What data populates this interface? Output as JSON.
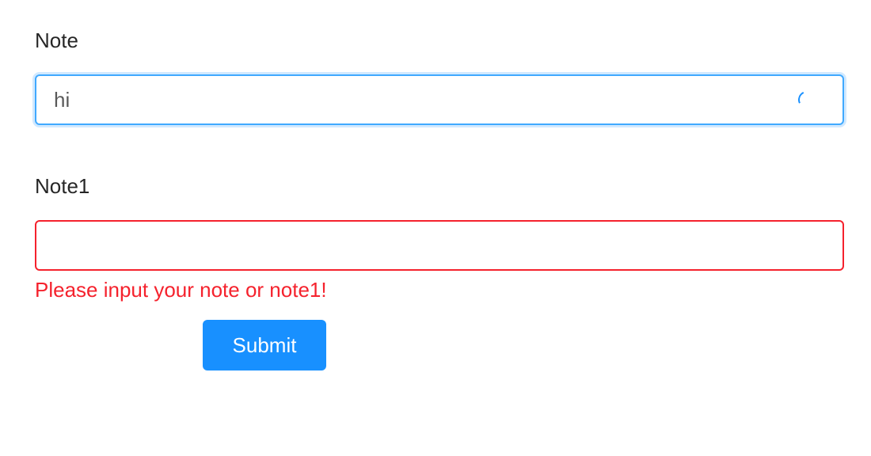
{
  "form": {
    "note": {
      "label": "Note",
      "value": "hi",
      "state": "validating"
    },
    "note1": {
      "label": "Note1",
      "value": "",
      "error": "Please input your note or note1!"
    },
    "submit_label": "Submit"
  },
  "colors": {
    "primary": "#1890ff",
    "focus_border": "#40a9ff",
    "error": "#f5222d",
    "text": "#262626"
  },
  "icons": {
    "validating": "loading-spinner-icon"
  }
}
